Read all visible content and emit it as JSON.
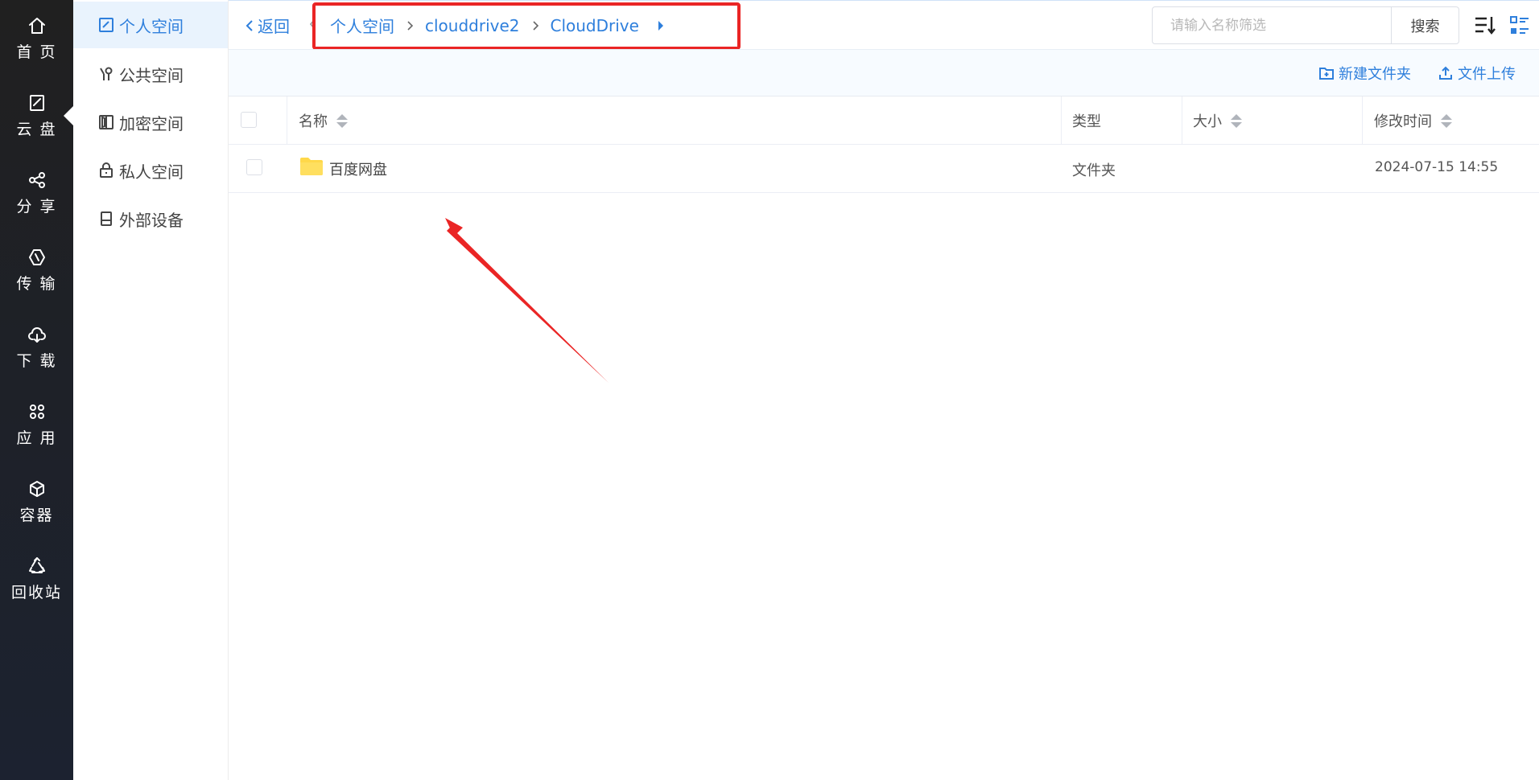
{
  "rail": {
    "items": [
      {
        "label": "首 页",
        "icon": "home-icon"
      },
      {
        "label": "云 盘",
        "icon": "cloud-disk-icon"
      },
      {
        "label": "分 享",
        "icon": "share-icon"
      },
      {
        "label": "传 输",
        "icon": "transfer-icon"
      },
      {
        "label": "下 载",
        "icon": "download-icon"
      },
      {
        "label": "应 用",
        "icon": "apps-icon"
      },
      {
        "label": "容器",
        "icon": "container-icon"
      },
      {
        "label": "回收站",
        "icon": "recycle-icon"
      }
    ],
    "active_index": 1
  },
  "sidebar": {
    "items": [
      {
        "label": "个人空间",
        "icon": "personal-space-icon",
        "active": true
      },
      {
        "label": "公共空间",
        "icon": "public-space-icon"
      },
      {
        "label": "加密空间",
        "icon": "encrypted-space-icon"
      },
      {
        "label": "私人空间",
        "icon": "lock-icon"
      },
      {
        "label": "外部设备",
        "icon": "external-device-icon"
      }
    ]
  },
  "topbar": {
    "back_label": "返回",
    "breadcrumb": [
      "个人空间",
      "clouddrive2",
      "CloudDrive"
    ],
    "search": {
      "placeholder": "请输入名称筛选",
      "value": ""
    },
    "search_button": "搜索"
  },
  "actions": {
    "new_folder": "新建文件夹",
    "upload": "文件上传"
  },
  "table": {
    "columns": [
      "名称",
      "类型",
      "大小",
      "修改时间"
    ],
    "rows": [
      {
        "name": "百度网盘",
        "type": "文件夹",
        "size": "",
        "modified": "2024-07-15 14:55"
      }
    ]
  },
  "colors": {
    "accent": "#2e7fdc",
    "rail_bg": "#1e2129",
    "annotation": "#ea2525",
    "folder": "#ffd84a"
  }
}
